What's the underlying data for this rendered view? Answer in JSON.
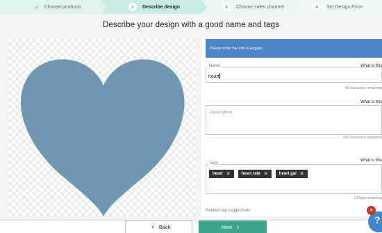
{
  "stepper": {
    "steps": [
      {
        "num": "✓",
        "label": "Choose products"
      },
      {
        "num": "2",
        "label": "Describe design"
      },
      {
        "num": "3",
        "label": "Choose sales channel"
      },
      {
        "num": "4",
        "label": "Set Design Price"
      }
    ]
  },
  "page_title": "Describe your design with a good name and tags",
  "design": {
    "shape": "heart",
    "color": "#6f97b1"
  },
  "form": {
    "info": "Please enter the info in English.",
    "name": {
      "label": "Name",
      "help": "What is this",
      "value": "heart",
      "remaining": "48 characters remaining"
    },
    "description": {
      "label": "Description",
      "help": "What is this",
      "placeholder": "",
      "remaining": "200 characters remaining"
    },
    "tags": {
      "label": "Tags",
      "help": "What is this",
      "items": [
        "heart",
        "heart rate",
        "heart gal"
      ],
      "remaining": "22 tags remaining"
    },
    "related": "Related tag suggestions:"
  },
  "footer": {
    "back_label": "Back",
    "next_label": "Next",
    "back_icon": "chevron-left-icon",
    "next_icon": "chevron-right-icon"
  },
  "help_widget": {
    "badge": "4",
    "icon": "question-icon"
  },
  "colors": {
    "accent": "#3ea58c",
    "info": "#4a86c5",
    "tag_bg": "#333333",
    "badge": "#c0392b"
  }
}
